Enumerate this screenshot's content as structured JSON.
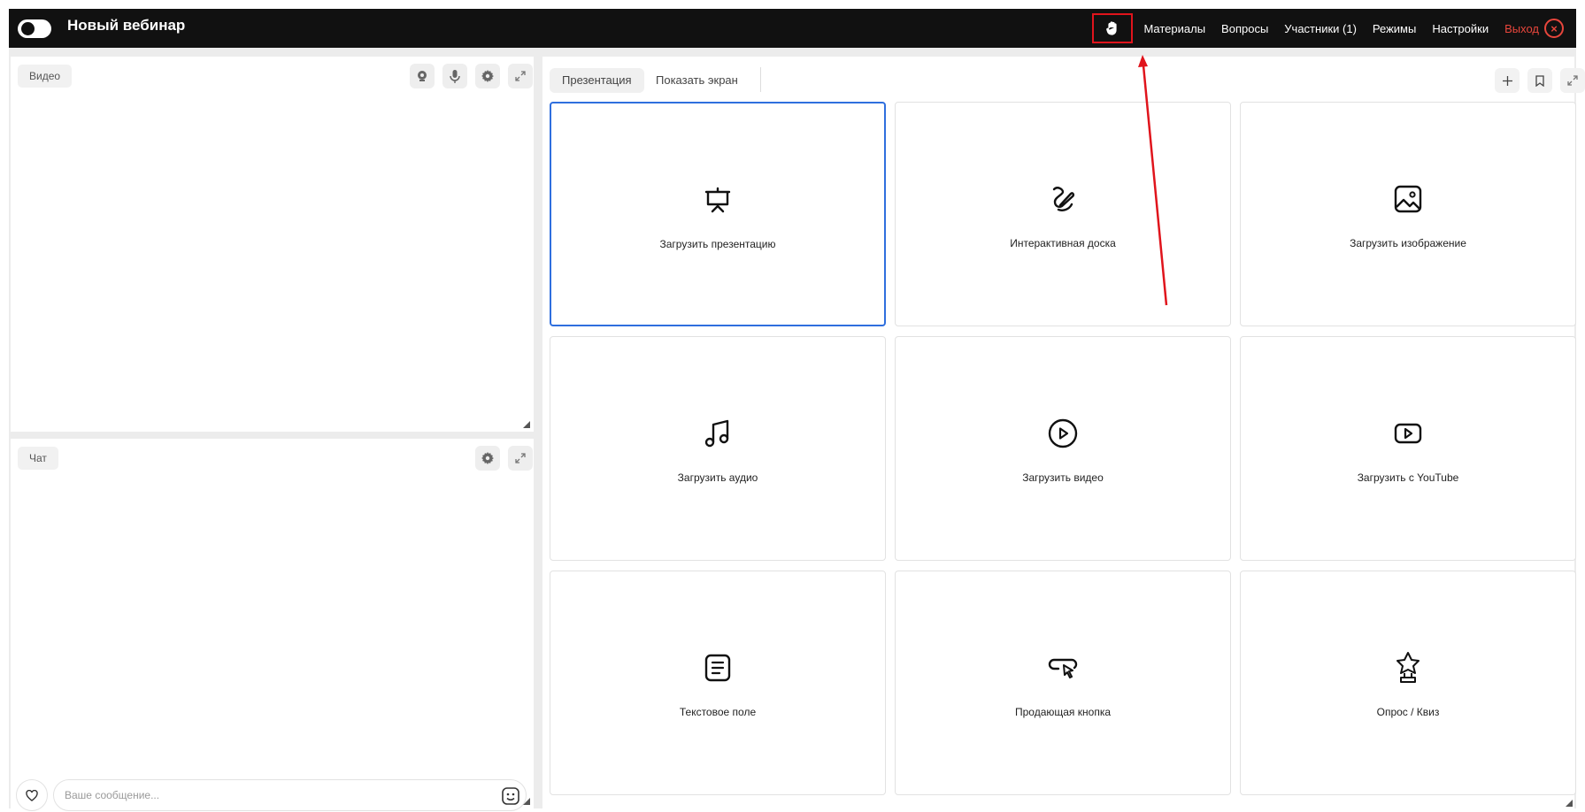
{
  "header": {
    "title": "Новый вебинар",
    "raise_hand_icon": "hand-icon",
    "nav": [
      {
        "label": "Материалы"
      },
      {
        "label": "Вопросы"
      },
      {
        "label": "Участники (1)"
      },
      {
        "label": "Режимы"
      },
      {
        "label": "Настройки"
      }
    ],
    "exit_label": "Выход",
    "exit_color": "#e8463c",
    "highlight_color": "#e0141c"
  },
  "video_panel": {
    "label": "Видео",
    "icons": [
      "webcam-icon",
      "microphone-icon",
      "gear-icon",
      "expand-icon"
    ]
  },
  "chat_panel": {
    "label": "Чат",
    "icons": [
      "gear-icon",
      "expand-icon"
    ],
    "input_placeholder": "Ваше сообщение...",
    "input_value": ""
  },
  "content_panel": {
    "tabs": [
      {
        "label": "Презентация",
        "active": true
      },
      {
        "label": "Показать экран",
        "active": false
      }
    ],
    "toolbar_icons": [
      "plus-icon",
      "bookmark-icon",
      "expand-icon"
    ],
    "cards": [
      {
        "label": "Загрузить презентацию",
        "icon": "presentation-icon",
        "selected": true
      },
      {
        "label": "Интерактивная доска",
        "icon": "whiteboard-icon",
        "selected": false
      },
      {
        "label": "Загрузить изображение",
        "icon": "image-icon",
        "selected": false
      },
      {
        "label": "Загрузить аудио",
        "icon": "music-note-icon",
        "selected": false
      },
      {
        "label": "Загрузить видео",
        "icon": "play-circle-icon",
        "selected": false
      },
      {
        "label": "Загрузить с YouTube",
        "icon": "youtube-icon",
        "selected": false
      },
      {
        "label": "Текстовое поле",
        "icon": "text-field-icon",
        "selected": false
      },
      {
        "label": "Продающая кнопка",
        "icon": "click-button-icon",
        "selected": false
      },
      {
        "label": "Опрос / Квиз",
        "icon": "trophy-star-icon",
        "selected": false
      }
    ],
    "accent": "#2f6fde"
  }
}
